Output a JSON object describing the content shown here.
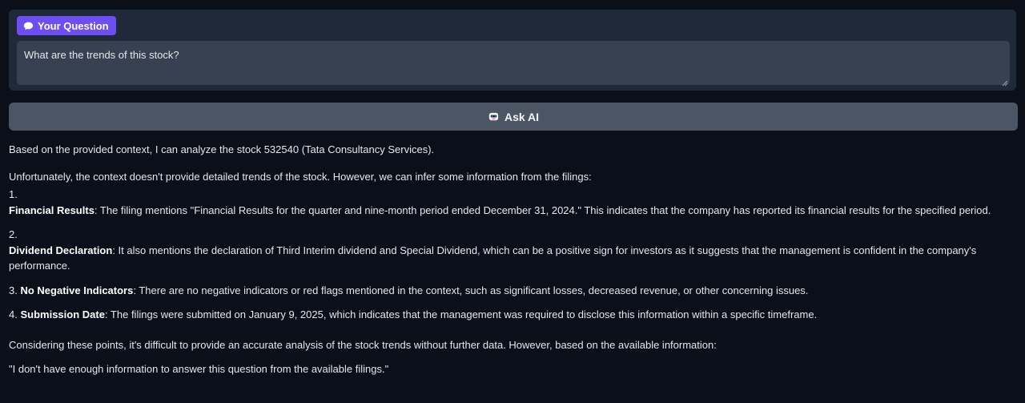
{
  "question_section": {
    "badge_label": "Your Question",
    "badge_icon": "speech-bubble-icon",
    "question_value": "What are the trends of this stock?"
  },
  "ask_button": {
    "label": "Ask AI",
    "icon": "robot-icon"
  },
  "answer": {
    "intro": "Based on the provided context, I can analyze the stock 532540 (Tata Consultancy Services).",
    "unfortunately": "Unfortunately, the context doesn't provide detailed trends of the stock. However, we can infer some information from the filings:",
    "items": [
      {
        "number": "1.",
        "title": "Financial Results",
        "text": ": The filing mentions \"Financial Results for the quarter and nine-month period ended December 31, 2024.\" This indicates that the company has reported its financial results for the specified period."
      },
      {
        "number": "2.",
        "title": "Dividend Declaration",
        "text": ": It also mentions the declaration of Third Interim dividend and Special Dividend, which can be a positive sign for investors as it suggests that the management is confident in the company's performance."
      },
      {
        "number": "3.",
        "title": "No Negative Indicators",
        "text": ": There are no negative indicators or red flags mentioned in the context, such as significant losses, decreased revenue, or other concerning issues."
      },
      {
        "number": "4.",
        "title": "Submission Date",
        "text": ": The filings were submitted on January 9, 2025, which indicates that the management was required to disclose this information within a specific timeframe."
      }
    ],
    "considering": "Considering these points, it's difficult to provide an accurate analysis of the stock trends without further data. However, based on the available information:",
    "conclusion": "\"I don't have enough information to answer this question from the available filings.\""
  }
}
